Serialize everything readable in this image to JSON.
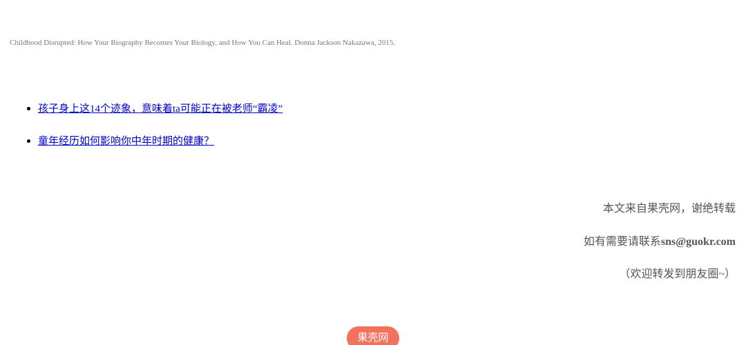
{
  "reference": {
    "citation": "Childhood Disrupted: How Your Biography Becomes Your Biology, and How You Can Heal. Donna Jackson Nakazawa, 2015."
  },
  "related": {
    "items": [
      {
        "label": "孩子身上这14个迹象，意味着ta可能正在被老师“霸凌”"
      },
      {
        "label": "童年经历如何影响你中年时期的健康？"
      }
    ]
  },
  "notice": {
    "line1": "本文来自果壳网，谢绝转载",
    "line2_prefix": "如有需要请联系",
    "line2_email": "sns@guokr.com",
    "line3": "（欢迎转发到朋友圈~）"
  },
  "footer": {
    "brand": "果壳网",
    "brand_color": "#f4715e"
  }
}
